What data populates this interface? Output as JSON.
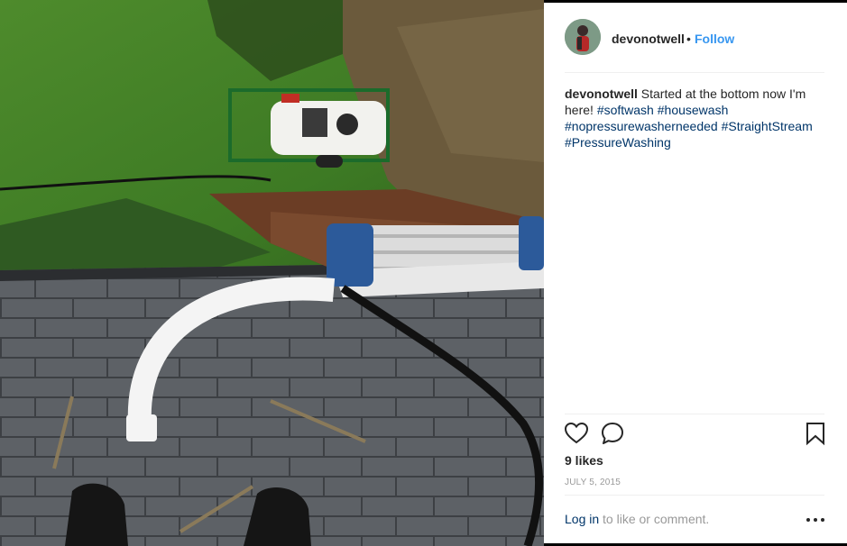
{
  "post": {
    "username": "devonotwell",
    "separator": "•",
    "follow_label": "Follow",
    "caption": {
      "username": "devonotwell",
      "text": "Started at the bottom now I'm here!",
      "hashtags": [
        "#softwash",
        "#housewash",
        "#nopressurewasherneeded",
        "#StraightStream",
        "#PressureWashing"
      ]
    },
    "likes": "9 likes",
    "date": "JULY 5, 2015",
    "login_link": "Log in",
    "login_suffix": "to like or comment."
  },
  "icons": {
    "like": "heart-icon",
    "comment": "comment-icon",
    "save": "bookmark-icon",
    "more": "more-options-icon"
  },
  "colors": {
    "link_blue": "#3897f0",
    "hashtag": "#003569",
    "text": "#262626",
    "muted": "#999999"
  }
}
